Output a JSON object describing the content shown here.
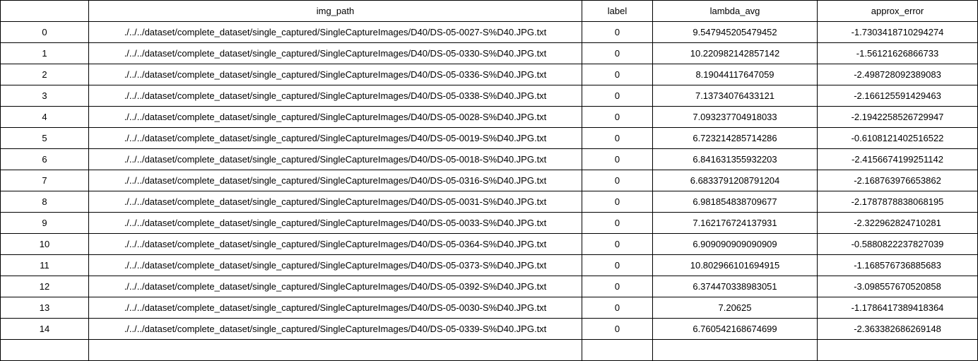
{
  "table": {
    "columns": [
      "",
      "img_path",
      "label",
      "lambda_avg",
      "approx_error"
    ],
    "rows": [
      [
        "0",
        "./../../dataset/complete_dataset/single_captured/SingleCaptureImages/D40/DS-05-0027-S%D40.JPG.txt",
        "0",
        "9.547945205479452",
        "-1.7303418710294274"
      ],
      [
        "1",
        "./../../dataset/complete_dataset/single_captured/SingleCaptureImages/D40/DS-05-0330-S%D40.JPG.txt",
        "0",
        "10.220982142857142",
        "-1.56121626866733"
      ],
      [
        "2",
        "./../../dataset/complete_dataset/single_captured/SingleCaptureImages/D40/DS-05-0336-S%D40.JPG.txt",
        "0",
        "8.19044117647059",
        "-2.498728092389083"
      ],
      [
        "3",
        "./../../dataset/complete_dataset/single_captured/SingleCaptureImages/D40/DS-05-0338-S%D40.JPG.txt",
        "0",
        "7.13734076433121",
        "-2.166125591429463"
      ],
      [
        "4",
        "./../../dataset/complete_dataset/single_captured/SingleCaptureImages/D40/DS-05-0028-S%D40.JPG.txt",
        "0",
        "7.093237704918033",
        "-2.1942258526729947"
      ],
      [
        "5",
        "./../../dataset/complete_dataset/single_captured/SingleCaptureImages/D40/DS-05-0019-S%D40.JPG.txt",
        "0",
        "6.723214285714286",
        "-0.6108121402516522"
      ],
      [
        "6",
        "./../../dataset/complete_dataset/single_captured/SingleCaptureImages/D40/DS-05-0018-S%D40.JPG.txt",
        "0",
        "6.841631355932203",
        "-2.4156674199251142"
      ],
      [
        "7",
        "./../../dataset/complete_dataset/single_captured/SingleCaptureImages/D40/DS-05-0316-S%D40.JPG.txt",
        "0",
        "6.6833791208791204",
        "-2.168763976653862"
      ],
      [
        "8",
        "./../../dataset/complete_dataset/single_captured/SingleCaptureImages/D40/DS-05-0031-S%D40.JPG.txt",
        "0",
        "6.981854838709677",
        "-2.1787878838068195"
      ],
      [
        "9",
        "./../../dataset/complete_dataset/single_captured/SingleCaptureImages/D40/DS-05-0033-S%D40.JPG.txt",
        "0",
        "7.162176724137931",
        "-2.322962824710281"
      ],
      [
        "10",
        "./../../dataset/complete_dataset/single_captured/SingleCaptureImages/D40/DS-05-0364-S%D40.JPG.txt",
        "0",
        "6.909090909090909",
        "-0.5880822237827039"
      ],
      [
        "11",
        "./../../dataset/complete_dataset/single_captured/SingleCaptureImages/D40/DS-05-0373-S%D40.JPG.txt",
        "0",
        "10.802966101694915",
        "-1.168576736885683"
      ],
      [
        "12",
        "./../../dataset/complete_dataset/single_captured/SingleCaptureImages/D40/DS-05-0392-S%D40.JPG.txt",
        "0",
        "6.374470338983051",
        "-3.098557670520858"
      ],
      [
        "13",
        "./../../dataset/complete_dataset/single_captured/SingleCaptureImages/D40/DS-05-0030-S%D40.JPG.txt",
        "0",
        "7.20625",
        "-1.1786417389418364"
      ],
      [
        "14",
        "./../../dataset/complete_dataset/single_captured/SingleCaptureImages/D40/DS-05-0339-S%D40.JPG.txt",
        "0",
        "6.760542168674699",
        "-2.363382686269148"
      ],
      [
        "",
        "",
        "",
        "",
        ""
      ]
    ]
  }
}
